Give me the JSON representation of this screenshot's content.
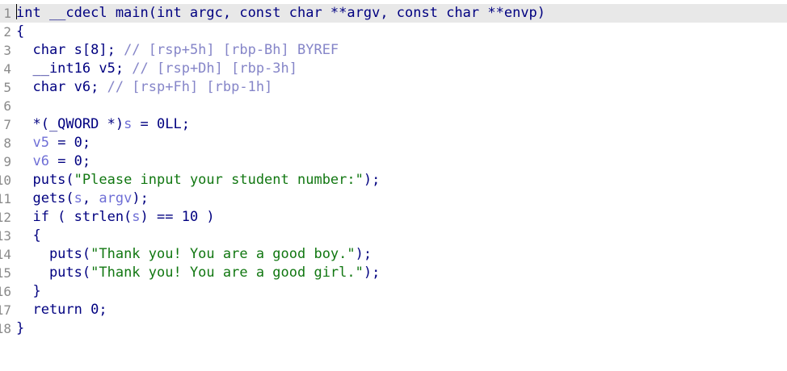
{
  "editor": {
    "lines": [
      {
        "num": "1",
        "tokens": [
          {
            "t": "int __cdecl main(int argc, const char **argv, const char **envp)",
            "c": "kw"
          }
        ]
      },
      {
        "num": "2",
        "tokens": [
          {
            "t": "{",
            "c": "kw"
          }
        ]
      },
      {
        "num": "3",
        "tokens": [
          {
            "t": "  char s[8]; ",
            "c": "kw"
          },
          {
            "t": "// [rsp+5h] [rbp-Bh] BYREF",
            "c": "cm"
          }
        ]
      },
      {
        "num": "4",
        "tokens": [
          {
            "t": "  __int16 v5; ",
            "c": "kw"
          },
          {
            "t": "// [rsp+Dh] [rbp-3h]",
            "c": "cm"
          }
        ]
      },
      {
        "num": "5",
        "tokens": [
          {
            "t": "  char v6; ",
            "c": "kw"
          },
          {
            "t": "// [rsp+Fh] [rbp-1h]",
            "c": "cm"
          }
        ]
      },
      {
        "num": "6",
        "tokens": []
      },
      {
        "num": "7",
        "tokens": [
          {
            "t": "  *(_QWORD *)",
            "c": "kw"
          },
          {
            "t": "s",
            "c": "var"
          },
          {
            "t": " = 0LL;",
            "c": "kw"
          }
        ]
      },
      {
        "num": "8",
        "tokens": [
          {
            "t": "  ",
            "c": "kw"
          },
          {
            "t": "v5",
            "c": "var"
          },
          {
            "t": " = 0;",
            "c": "kw"
          }
        ]
      },
      {
        "num": "9",
        "tokens": [
          {
            "t": "  ",
            "c": "kw"
          },
          {
            "t": "v6",
            "c": "var"
          },
          {
            "t": " = 0;",
            "c": "kw"
          }
        ]
      },
      {
        "num": "10",
        "tokens": [
          {
            "t": "  puts(",
            "c": "kw"
          },
          {
            "t": "\"Please input your student number:\"",
            "c": "str"
          },
          {
            "t": ");",
            "c": "kw"
          }
        ]
      },
      {
        "num": "11",
        "tokens": [
          {
            "t": "  gets(",
            "c": "kw"
          },
          {
            "t": "s",
            "c": "var"
          },
          {
            "t": ", ",
            "c": "kw"
          },
          {
            "t": "argv",
            "c": "var"
          },
          {
            "t": ");",
            "c": "kw"
          }
        ]
      },
      {
        "num": "12",
        "tokens": [
          {
            "t": "  if ( strlen(",
            "c": "kw"
          },
          {
            "t": "s",
            "c": "var"
          },
          {
            "t": ") == 10 )",
            "c": "kw"
          }
        ]
      },
      {
        "num": "13",
        "tokens": [
          {
            "t": "  {",
            "c": "kw"
          }
        ]
      },
      {
        "num": "14",
        "tokens": [
          {
            "t": "    puts(",
            "c": "kw"
          },
          {
            "t": "\"Thank you! You are a good boy.\"",
            "c": "str"
          },
          {
            "t": ");",
            "c": "kw"
          }
        ]
      },
      {
        "num": "15",
        "tokens": [
          {
            "t": "    puts(",
            "c": "kw"
          },
          {
            "t": "\"Thank you! You are a good girl.\"",
            "c": "str"
          },
          {
            "t": ");",
            "c": "kw"
          }
        ]
      },
      {
        "num": "16",
        "tokens": [
          {
            "t": "  }",
            "c": "kw"
          }
        ]
      },
      {
        "num": "17",
        "tokens": [
          {
            "t": "  return 0;",
            "c": "kw"
          }
        ]
      },
      {
        "num": "18",
        "tokens": [
          {
            "t": "}",
            "c": "kw"
          }
        ]
      }
    ]
  },
  "colors": {
    "keyword": "#000080",
    "variable": "#6f6fd6",
    "comment": "#8585c8",
    "string": "#117711",
    "line_number": "#8a8a8a",
    "current_line_bg": "#e8e8e8"
  }
}
